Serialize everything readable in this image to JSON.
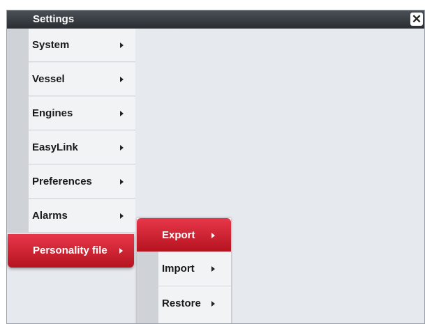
{
  "window": {
    "title": "Settings",
    "close_symbol": "✕"
  },
  "menu": {
    "items": [
      {
        "label": "System"
      },
      {
        "label": "Vessel"
      },
      {
        "label": "Engines"
      },
      {
        "label": "EasyLink"
      },
      {
        "label": "Preferences"
      },
      {
        "label": "Alarms"
      },
      {
        "label": "Personality file",
        "selected": true
      }
    ]
  },
  "submenu": {
    "items": [
      {
        "label": "Export",
        "selected": true
      },
      {
        "label": "Import"
      },
      {
        "label": "Restore"
      }
    ]
  },
  "colors": {
    "accent": "#d42232",
    "titlebar": "#3a3e44",
    "background": "#e6e9ee"
  }
}
